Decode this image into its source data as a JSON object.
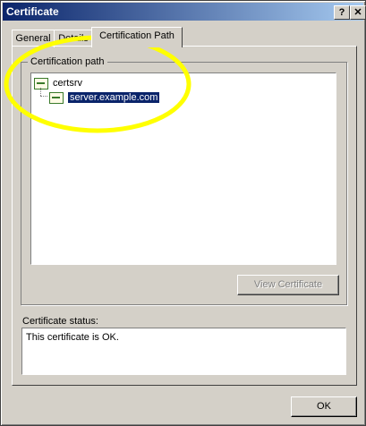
{
  "window": {
    "title": "Certificate",
    "help_label": "?",
    "close_label": "✕"
  },
  "tabs": [
    {
      "label": "General"
    },
    {
      "label": "Details"
    },
    {
      "label": "Certification Path",
      "active": true
    }
  ],
  "cert_path": {
    "group_label": "Certification path",
    "items": [
      {
        "label": "certsrv",
        "icon": "certificate-icon"
      },
      {
        "label": "server.example.com",
        "icon": "certificate-icon",
        "selected": true
      }
    ],
    "view_button": "View Certificate"
  },
  "status": {
    "label": "Certificate status:",
    "text": "This certificate is OK."
  },
  "ok_button": "OK",
  "colors": {
    "title_bar": "#0a246a",
    "highlight": "#ffff00",
    "selection": "#0a246a"
  }
}
